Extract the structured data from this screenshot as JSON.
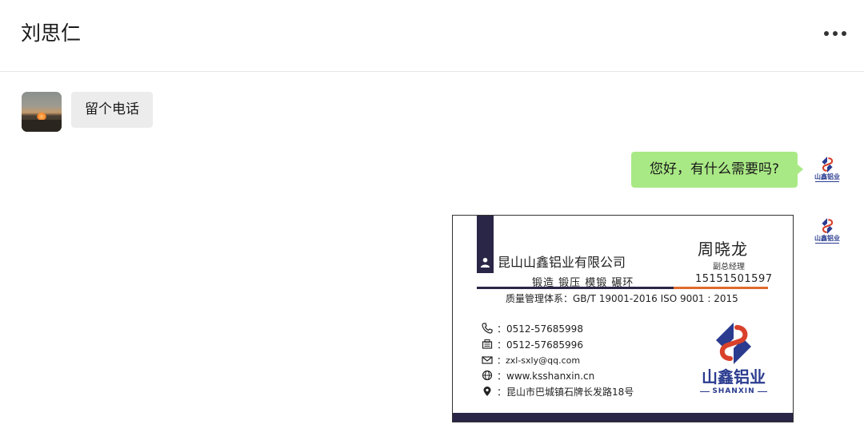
{
  "header": {
    "title": "刘思仁",
    "more_icon": "more-horizontal-icon"
  },
  "messages": [
    {
      "side": "left",
      "text": "留个电话"
    },
    {
      "side": "right",
      "text": "您好，有什么需要吗?"
    }
  ],
  "contact_avatar": {
    "name": "sunset-avatar"
  },
  "self_avatar": {
    "logo_text": "山鑫铝业",
    "icon": "shanxin-logo-icon"
  },
  "business_card": {
    "company": "昆山山鑫铝业有限公司",
    "services": "锻造  锻压  模锻  碾环",
    "name": "周晓龙",
    "position": "副总经理",
    "mobile": "15151501597",
    "quality": "质量管理体系：GB/T 19001-2016   ISO 9001 : 2015",
    "phone": "：0512-57685998",
    "fax": "：0512-57685996",
    "email": "：zxl-sxly@qq.com",
    "website": "：www.ksshanxin.cn",
    "address": "：昆山市巴城镇石牌长发路18号",
    "logo_text": "山鑫铝业",
    "logo_sub": "SHANXIN",
    "colors": {
      "navy": "#2a2647",
      "orange": "#e06a2b",
      "logo_blue": "#2a3b8f",
      "logo_red": "#d9412b"
    }
  },
  "colors": {
    "bubble_in": "#ececec",
    "bubble_out": "#a9e985",
    "divider": "#e6e6e6"
  }
}
